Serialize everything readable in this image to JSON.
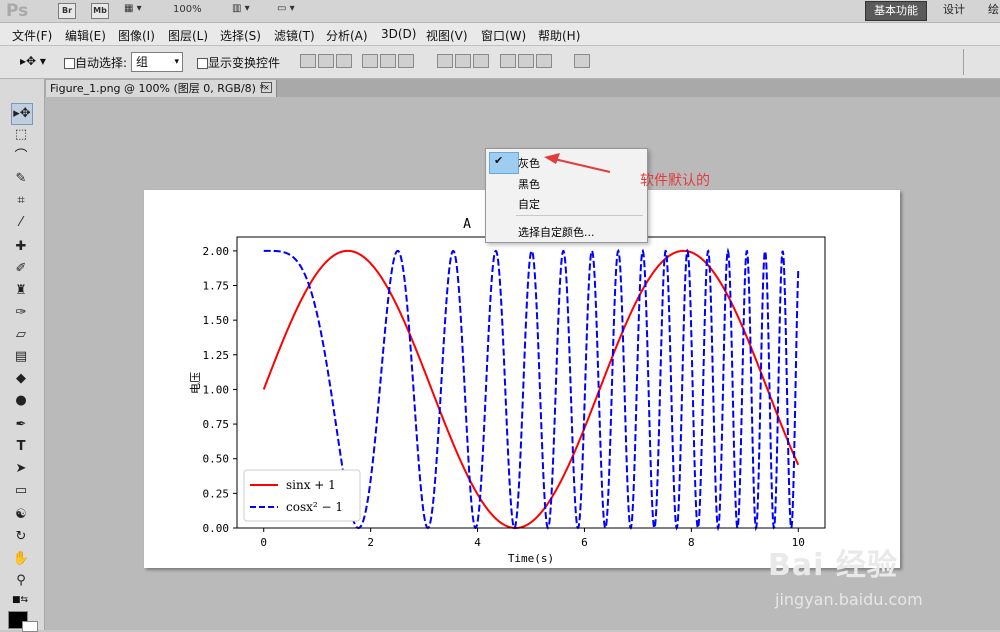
{
  "app": {
    "logo": "Ps",
    "launch_buttons": [
      "Br",
      "Mb"
    ],
    "zoom": "100%",
    "workspace_active": "基本功能",
    "workspace_items": [
      "设计",
      "绘"
    ]
  },
  "menu": [
    "文件(F)",
    "编辑(E)",
    "图像(I)",
    "图层(L)",
    "选择(S)",
    "滤镜(T)",
    "分析(A)",
    "3D(D)",
    "视图(V)",
    "窗口(W)",
    "帮助(H)"
  ],
  "options": {
    "auto_select_label": "自动选择:",
    "auto_select_value": "组",
    "show_transform_label": "显示变换控件"
  },
  "document": {
    "tab_title": "Figure_1.png @ 100% (图层 0, RGB/8) *"
  },
  "context_menu": {
    "items": [
      "灰色",
      "黑色",
      "自定",
      "选择自定颜色..."
    ],
    "checked": "灰色"
  },
  "annotation": {
    "text": "软件默认的",
    "color": "#e23c3c"
  },
  "watermark": {
    "brand": "Bai 经验",
    "url": "jingyan.baidu.com"
  },
  "chart_data": {
    "type": "line",
    "title": "A",
    "xlabel": "Time(s)",
    "ylabel": "电压",
    "xlim": [
      -0.5,
      10.5
    ],
    "ylim": [
      0,
      2.1
    ],
    "xticks": [
      "0",
      "2",
      "4",
      "6",
      "8",
      "10"
    ],
    "yticks": [
      "0.00",
      "0.25",
      "0.50",
      "0.75",
      "1.00",
      "1.25",
      "1.50",
      "1.75",
      "2.00"
    ],
    "series": [
      {
        "name": "sinx + 1",
        "color": "#ff0000",
        "style": "solid",
        "function": "sin(x)+1",
        "x_range": [
          0,
          10
        ]
      },
      {
        "name": "cosx² − 1",
        "color": "#0000ff",
        "style": "dashed",
        "function": "cos(x^2)+1",
        "x_range": [
          0,
          10
        ]
      }
    ],
    "legend": "lower-left"
  }
}
